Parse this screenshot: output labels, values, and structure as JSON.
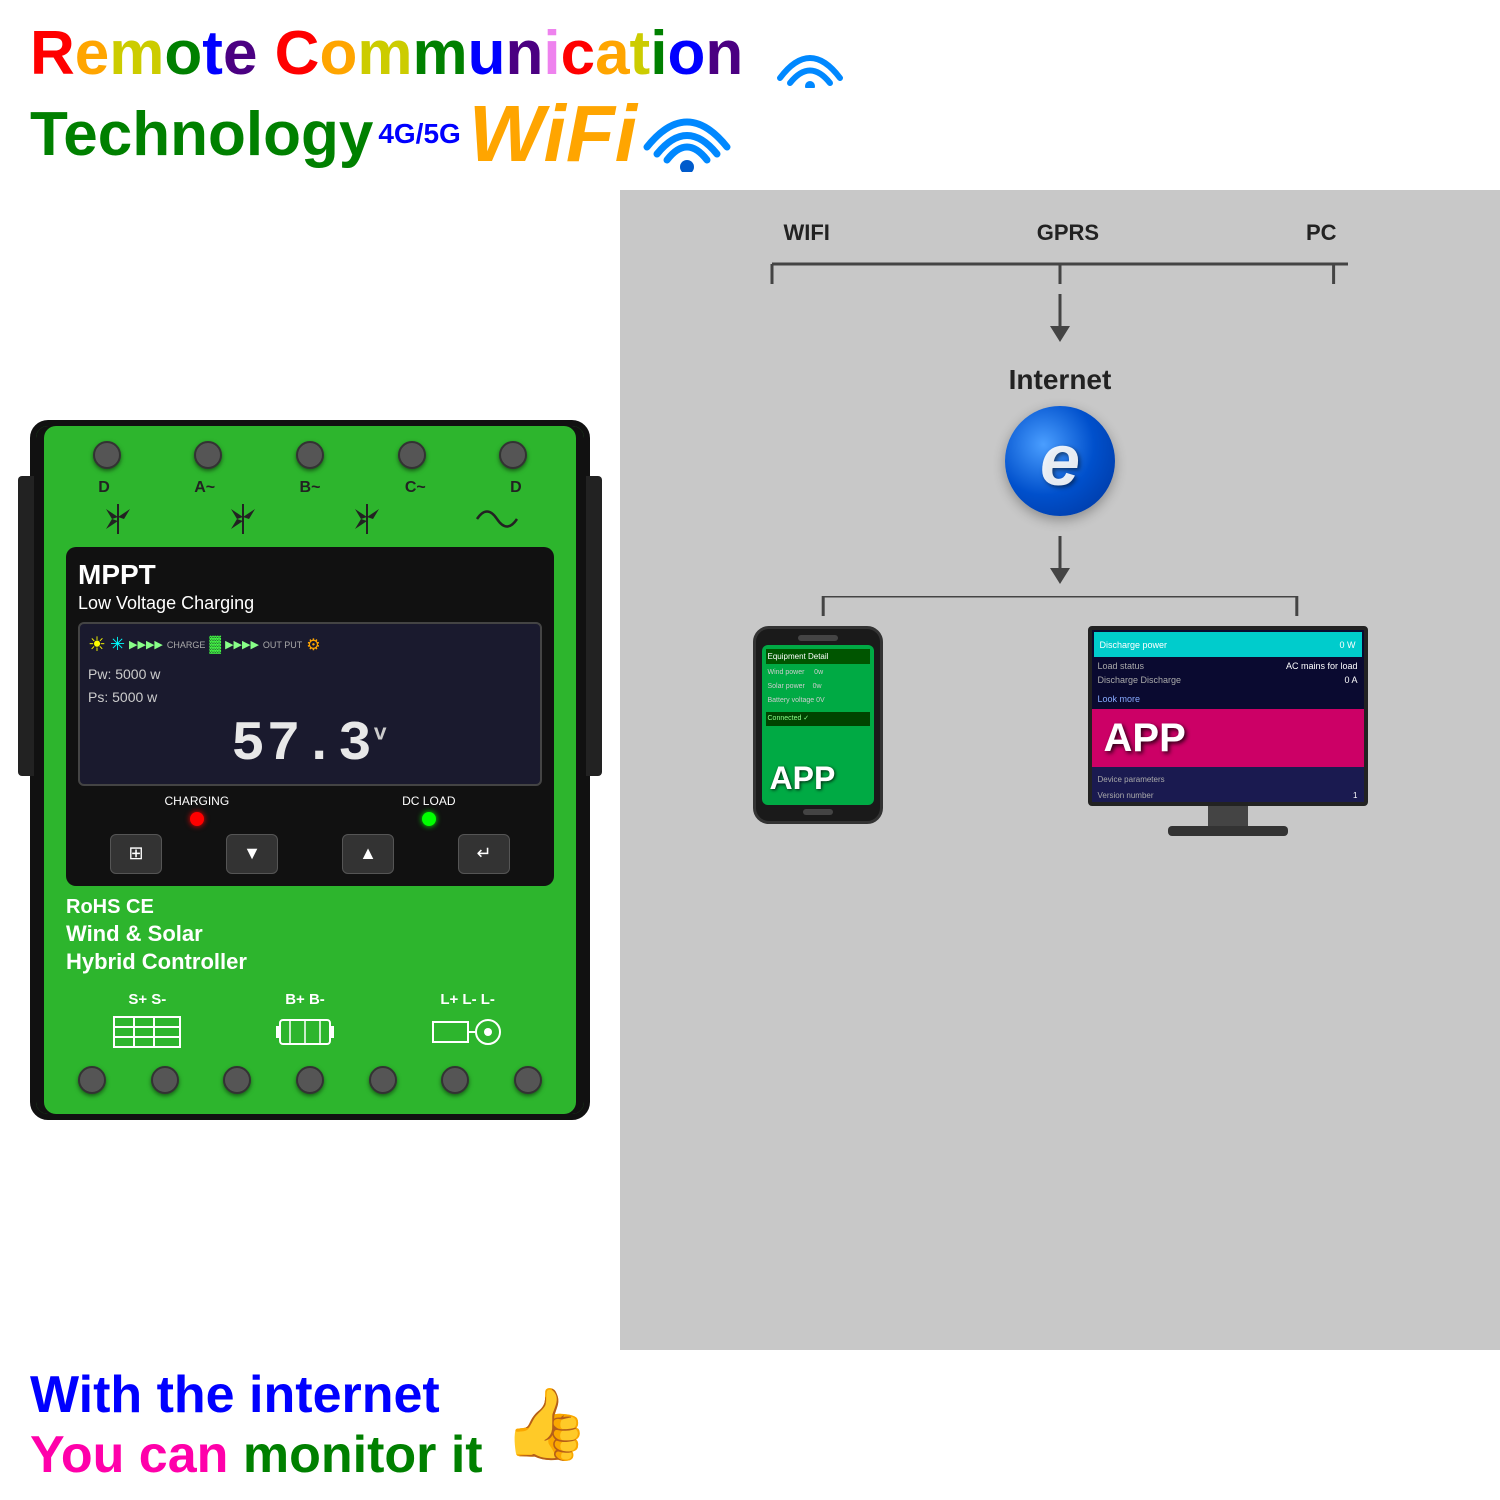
{
  "header": {
    "line1": "Remote Communication",
    "line2_tech": "Technology",
    "line2_4g5g": "4G/5G",
    "line2_wifi": "WiFi"
  },
  "device": {
    "terminal_labels": [
      "D",
      "A~",
      "B~",
      "C~",
      "D"
    ],
    "display": {
      "title": "MPPT",
      "subtitle": "Low Voltage Charging",
      "pw": "Pw: 5000 w",
      "ps": "Ps: 5000 w",
      "voltage": "57.3",
      "volt_unit": "v",
      "charging_label": "CHARGING",
      "dc_load_label": "DC LOAD"
    },
    "rohs": "RoHS CE",
    "wind_solar": "Wind & Solar",
    "hybrid": "Hybrid  Controller",
    "terminal_bottom": {
      "solar": {
        "label": "S+ S-",
        "symbol": "⊞⊞⊞"
      },
      "battery": {
        "label": "B+ B-",
        "symbol": "⊟⊟"
      },
      "load": {
        "label": "L+ L- L-",
        "symbol": "⊕⊕"
      }
    }
  },
  "diagram": {
    "top_labels": [
      "WIFI",
      "GPRS",
      "PC"
    ],
    "internet_label": "Internet",
    "app_phone_label": "APP",
    "app_monitor_label": "APP",
    "phone_screen": {
      "line1": "Equipment Detail",
      "line2": "Wind power",
      "line3": "Solar power",
      "line4": "Battery voltage"
    },
    "monitor_screen": {
      "row1_label": "Discharge power",
      "row1_value": "0 W",
      "row2_label": "Load status",
      "row2_value": "AC mains for load",
      "row3_label": "Discharge Discharge",
      "row3_value": "0 A",
      "row4_label": "Look more",
      "row5_label": "Device parameters",
      "row6_label": "Version number",
      "row6_value": "1"
    }
  },
  "footer": {
    "line1": "With the internet",
    "line2_part1": "You can",
    "line2_part2": "monitor it"
  },
  "colors": {
    "green_device": "#2db52d",
    "accent_orange": "#ff8c00",
    "accent_blue": "#0050cc"
  }
}
